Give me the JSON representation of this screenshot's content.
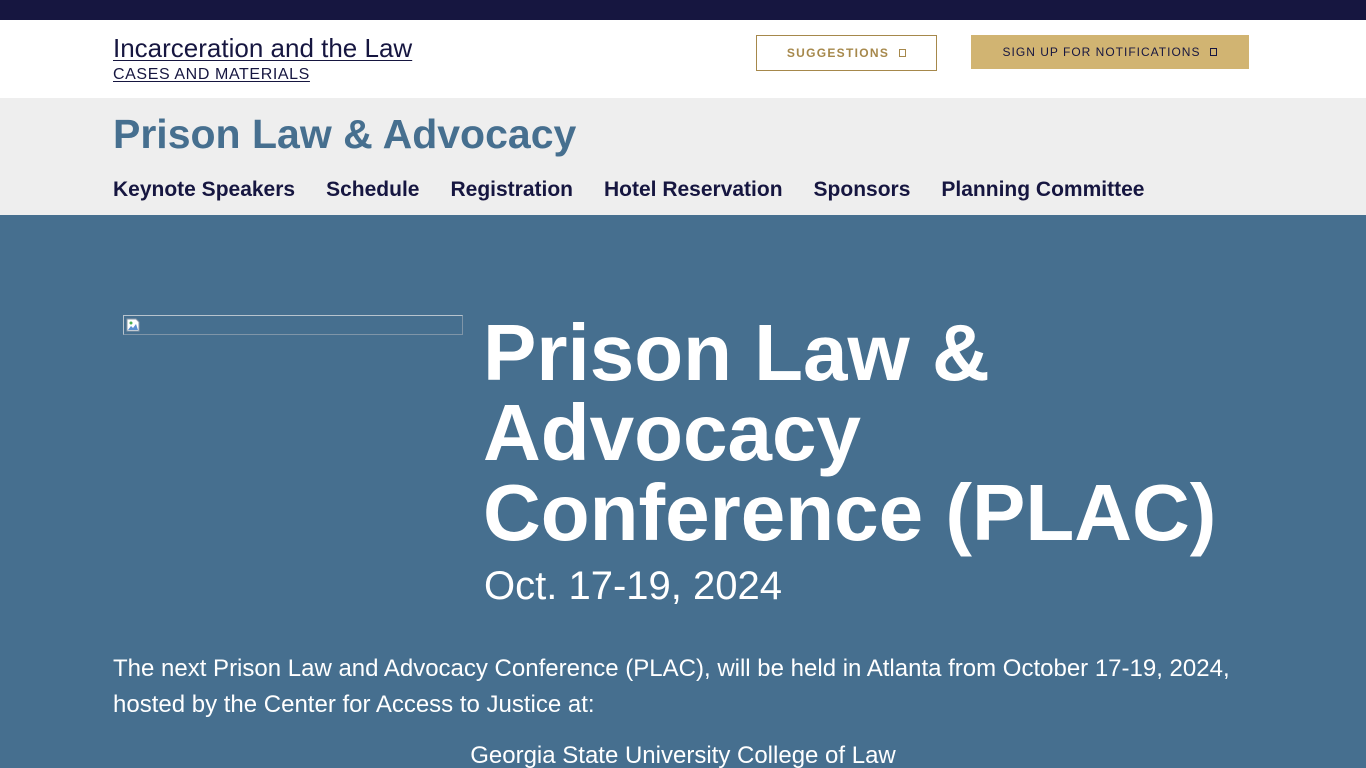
{
  "site": {
    "title": "Incarceration and the Law",
    "subtitle": "CASES AND MATERIALS"
  },
  "header_buttons": {
    "suggestions_label": "SUGGESTIONS",
    "notifications_label": "SIGN UP FOR NOTIFICATIONS"
  },
  "section": {
    "title": "Prison Law & Advocacy"
  },
  "nav": {
    "items": [
      {
        "label": "Keynote Speakers"
      },
      {
        "label": "Schedule"
      },
      {
        "label": "Registration"
      },
      {
        "label": "Hotel Reservation"
      },
      {
        "label": "Sponsors"
      },
      {
        "label": "Planning Committee"
      }
    ]
  },
  "hero": {
    "title": "Prison Law & Advocacy Conference (PLAC)",
    "date": "Oct. 17-19, 2024"
  },
  "content": {
    "intro": "The next Prison Law and Advocacy Conference (PLAC), will be held in Atlanta from October 17-19, 2024, hosted by the Center for Access to Justice at:",
    "venue": "Georgia State University College of Law"
  },
  "colors": {
    "top_bar": "#161640",
    "accent_blue": "#466f8f",
    "gold": "#d1b472",
    "gold_text": "#a6884b",
    "subheader_bg": "#eeeeee"
  },
  "icons": {
    "button_icon": "external-link-icon",
    "hero_image": "broken-image-icon"
  }
}
